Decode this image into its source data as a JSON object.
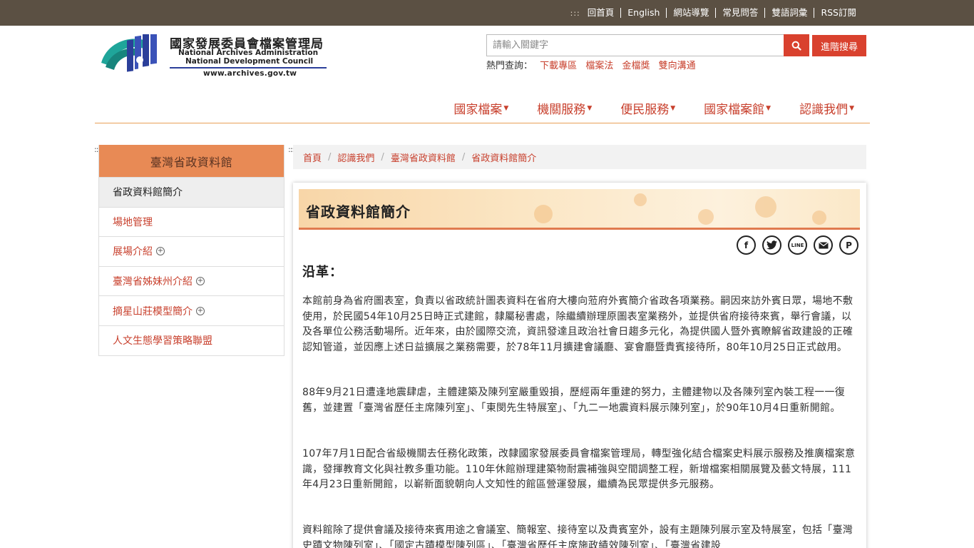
{
  "topbar": {
    "accesskey": ":::",
    "links": [
      "回首頁",
      "English",
      "網站導覽",
      "常見問答",
      "雙語詞彙",
      "RSS訂閱"
    ]
  },
  "logo": {
    "zh": "國家發展委員會檔案管理局",
    "en1": "National Archives Administration",
    "en2": "National Development Council",
    "url": "www.archives.gov.tw"
  },
  "search": {
    "placeholder": "請輸入關鍵字",
    "advanced_label": "進階搜尋",
    "hot_label": "熱門查詢：",
    "hot_items": [
      "下載專區",
      "檔案法",
      "金檔獎",
      "雙向溝通"
    ]
  },
  "mainnav": [
    "國家檔案",
    "機關服務",
    "便民服務",
    "國家檔案館",
    "認識我們"
  ],
  "sidebar": {
    "title": "臺灣省政資料館",
    "items": [
      {
        "label": "省政資料館簡介",
        "active": true,
        "expandable": false
      },
      {
        "label": "場地管理",
        "active": false,
        "expandable": false
      },
      {
        "label": "展場介紹",
        "active": false,
        "expandable": true
      },
      {
        "label": "臺灣省姊妹州介紹",
        "active": false,
        "expandable": true
      },
      {
        "label": "摘星山莊模型簡介",
        "active": false,
        "expandable": true
      },
      {
        "label": "人文生態學習策略聯盟",
        "active": false,
        "expandable": false
      }
    ]
  },
  "breadcrumb": [
    "首頁",
    "認識我們",
    "臺灣省政資料館",
    "省政資料館簡介"
  ],
  "content": {
    "title": "省政資料館簡介",
    "section_title": "沿革：",
    "share_icons": [
      "facebook-icon",
      "twitter-icon",
      "line-icon",
      "email-icon",
      "plurk-icon"
    ],
    "paragraphs": [
      "本館前身為省府圖表室，負責以省政統計圖表資料在省府大樓向蒞府外賓簡介省政各項業務。嗣因來訪外賓日眾，場地不敷使用，於民國54年10月25日時正式建館，隸屬秘書處，除繼續辦理原圖表室業務外，並提供省府接待來賓，舉行會議，以及各單位公務活動場所。近年來，由於國際交流，資訊發達且政治社會日趨多元化，為提供國人暨外賓瞭解省政建設的正確認知管道，並因應上述日益擴展之業務需要，於78年11月擴建會議廳、宴會廳暨貴賓接待所，80年10月25日正式啟用。",
      "88年9月21日遭逢地震肆虐，主體建築及陳列室嚴重毀損，歷經兩年重建的努力，主體建物以及各陳列室內裝工程一一復舊，並建置「臺灣省歷任主席陳列室」、「東閔先生特展室」、「九二一地震資料展示陳列室」，於90年10月4日重新開館。",
      "107年7月1日配合省級機關去任務化政策，改隸國家發展委員會檔案管理局，轉型強化結合檔案史料展示服務及推廣檔案意識，發揮教育文化與社教多重功能。110年休館辦理建築物耐震補強與空間調整工程，新增檔案相關展覽及藝文特展，111年4月23日重新開館，以嶄新面貌朝向人文知性的館區營運發展，繼續為民眾提供多元服務。",
      "資料館除了提供會議及接待來賓用途之會議室、簡報室、接待室以及貴賓室外，設有主題陳列展示室及特展室，包括「臺灣史蹟文物陳列室」、「國定古蹟模型陳列區」、「臺灣省歷任主席施政績效陳列室」、「臺灣省建設"
    ]
  },
  "colors": {
    "topbar_bg": "#5b5043",
    "accent_red": "#d9412e",
    "link_red": "#c8402d",
    "sidebar_head": "#e88a55",
    "nav_line": "#e8a057"
  }
}
